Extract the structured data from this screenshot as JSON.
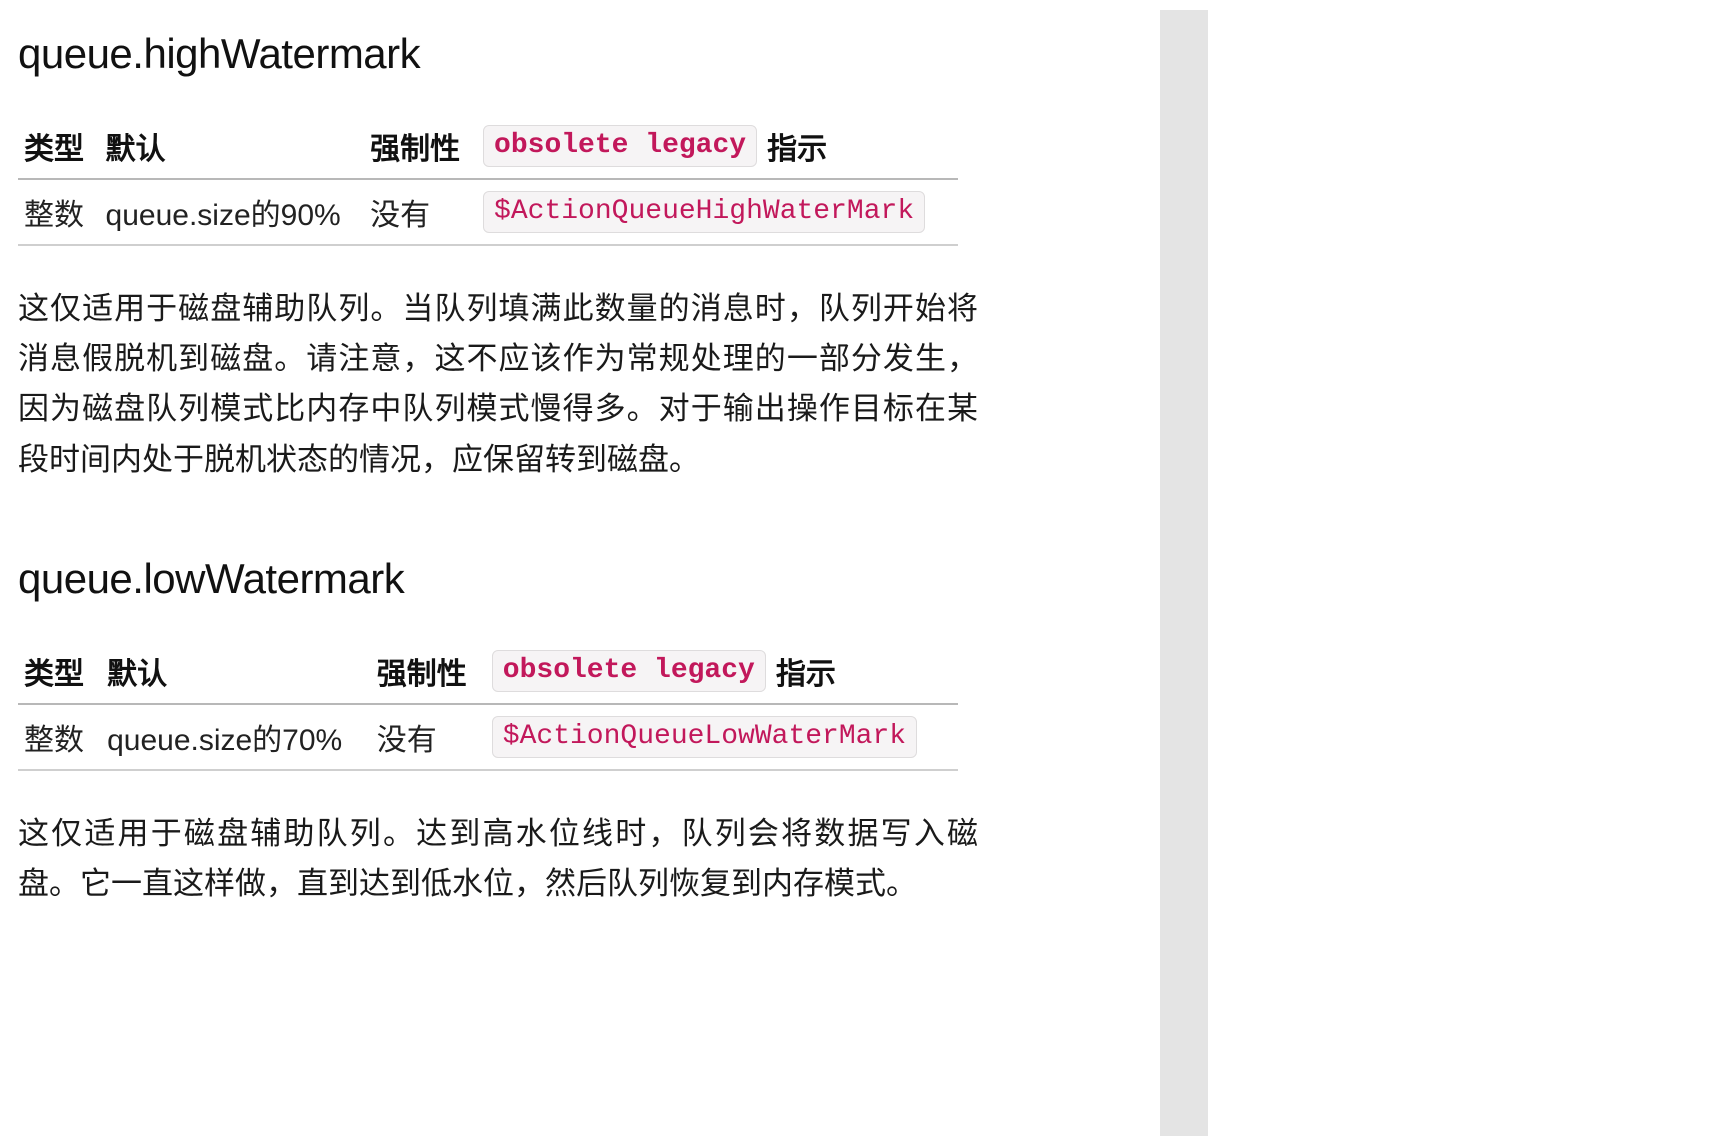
{
  "sections": [
    {
      "title": "queue.highWatermark",
      "table": {
        "headers": {
          "type": "类型",
          "default": "默认",
          "mandatory": "强制性",
          "legacy_badge": "obsolete legacy",
          "directive": "指示"
        },
        "row": {
          "type": "整数",
          "default": "queue.size的90%",
          "mandatory": "没有",
          "directive_code": "$ActionQueueHighWaterMark"
        }
      },
      "description": "这仅适用于磁盘辅助队列。当队列填满此数量的消息时，队列开始将消息假脱机到磁盘。请注意，这不应该作为常规处理的一部分发生，因为磁盘队列模式比内存中队列模式慢得多。对于输出操作目标在某段时间内处于脱机状态的情况，应保留转到磁盘。"
    },
    {
      "title": "queue.lowWatermark",
      "table": {
        "headers": {
          "type": "类型",
          "default": "默认",
          "mandatory": "强制性",
          "legacy_badge": "obsolete legacy",
          "directive": "指示"
        },
        "row": {
          "type": "整数",
          "default": "queue.size的70%",
          "mandatory": "没有",
          "directive_code": "$ActionQueueLowWaterMark"
        }
      },
      "description": "这仅适用于磁盘辅助队列。达到高水位线时，队列会将数据写入磁盘。它一直这样做，直到达到低水位，然后队列恢复到内存模式。"
    }
  ]
}
